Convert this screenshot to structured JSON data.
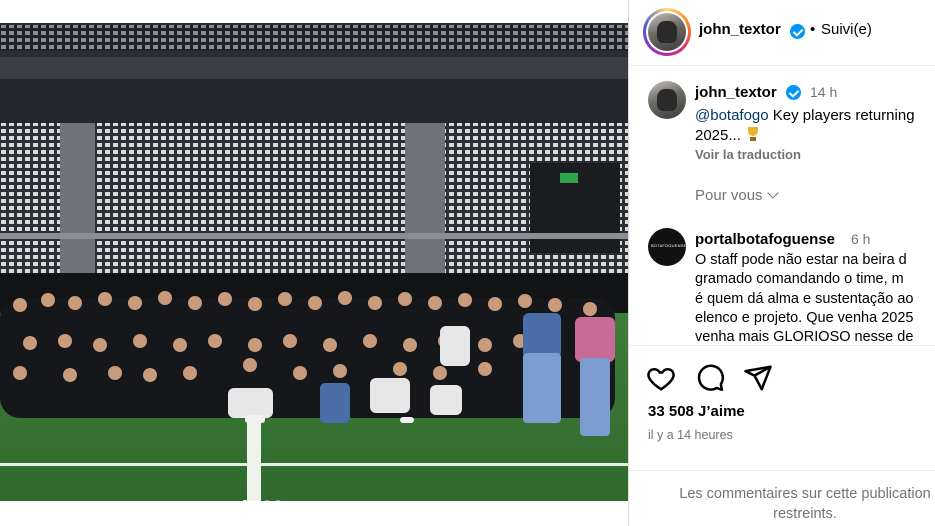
{
  "post": {
    "photo_alt": "Team photo in stadium",
    "carousel": {
      "count": 4,
      "active_index": 0
    }
  },
  "header": {
    "username": "john_textor",
    "separator": "•",
    "follow_status": "Suivi(e)"
  },
  "caption": {
    "username": "john_textor",
    "time": "14 h",
    "mention": "@botafogo",
    "text": " Key players returning",
    "text_line2": "2025...",
    "translate_label": "Voir la traduction",
    "for_you_label": "Pour vous"
  },
  "comment": {
    "username": "portalbotafoguense",
    "time": "6 h",
    "text": "O staff pode não estar na beira d\ngramado comandando o time, m\né quem dá alma e sustentação ao\nelenco e projeto. Que venha 2025\nvenha mais GLORIOSO nesse de"
  },
  "actions": {
    "likes": "33 508 J’aime",
    "posted": "il y a 14 heures",
    "restricted": "Les commentaires sur cette publication\nrestreints."
  },
  "colors": {
    "verified": "#0095f6",
    "muted": "#737373",
    "mention": "#00376b"
  },
  "icons": [
    "verified-badge-icon",
    "chevron-down-icon",
    "trophy-icon",
    "heart-icon",
    "comment-icon",
    "share-icon"
  ]
}
